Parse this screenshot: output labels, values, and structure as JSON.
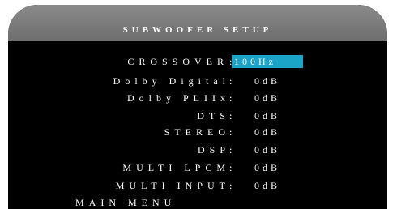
{
  "header": {
    "title": "SUBWOOFER SETUP"
  },
  "settings": [
    {
      "label": "CROSSOVER",
      "value": "100Hz"
    },
    {
      "label": "Dolby Digital",
      "value": "0dB"
    },
    {
      "label": "Dolby PLIIx",
      "value": "0dB"
    },
    {
      "label": "DTS",
      "value": "0dB"
    },
    {
      "label": "STEREO",
      "value": "0dB"
    },
    {
      "label": "DSP",
      "value": "0dB"
    },
    {
      "label": "MULTI LPCM",
      "value": "0dB"
    },
    {
      "label": "MULTI INPUT",
      "value": "0dB"
    }
  ],
  "colon": ":",
  "footer": {
    "main_menu_label": "MAIN MENU"
  },
  "colors": {
    "background": "#000000",
    "header": "#7a7a7a",
    "selection": "#1ba3c8",
    "text": "#ffffff"
  }
}
